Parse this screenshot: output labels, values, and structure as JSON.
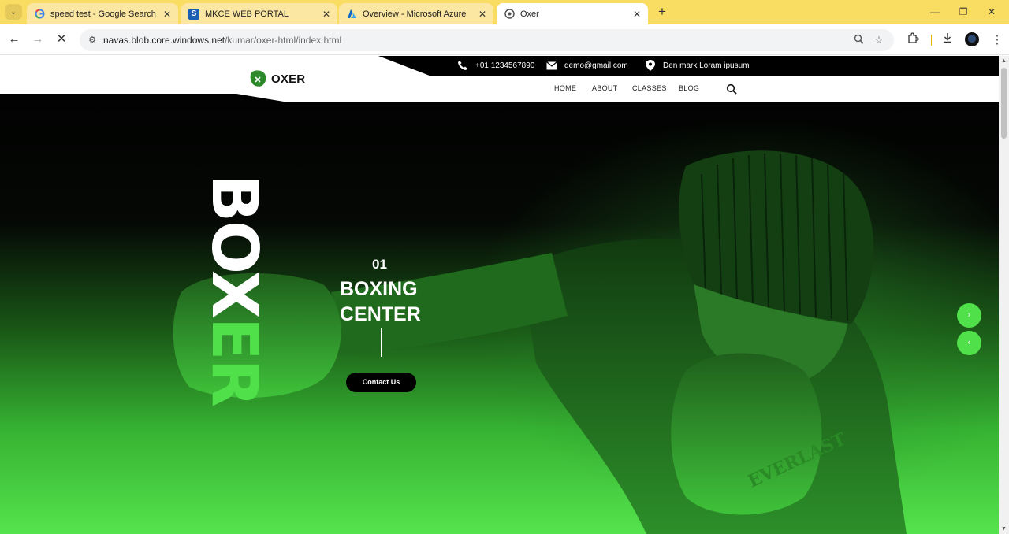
{
  "browser": {
    "tabs": [
      {
        "title": "speed test - Google Search",
        "icon": "google-icon",
        "active": false
      },
      {
        "title": "MKCE WEB PORTAL",
        "icon": "portal-icon",
        "active": false
      },
      {
        "title": "Overview - Microsoft Azure",
        "icon": "azure-icon",
        "active": false
      },
      {
        "title": "Oxer",
        "icon": "oxer-favicon-icon",
        "active": true
      }
    ],
    "tab_close_glyph": "✕",
    "new_tab_glyph": "+",
    "url_host": "navas.blob.core.windows.net",
    "url_path": "/kumar/oxer-html/index.html",
    "colors": {
      "tab_strip": "#f9dc62",
      "accent_green": "#4fe04a"
    }
  },
  "site": {
    "logo_text": "OXER",
    "contact": {
      "phone": "+01 1234567890",
      "email": "demo@gmail.com",
      "address": "Den mark Loram ipusum"
    },
    "nav": [
      "HOME",
      "ABOUT",
      "CLASSES",
      "BLOG"
    ],
    "hero": {
      "vertical_word_white": "BOX",
      "vertical_word_green": "ER",
      "slide_number": "01",
      "title_line1": "BOXING",
      "title_line2": "CENTER",
      "button_label": "Contact Us",
      "next_glyph": "›",
      "prev_glyph": "‹"
    }
  }
}
